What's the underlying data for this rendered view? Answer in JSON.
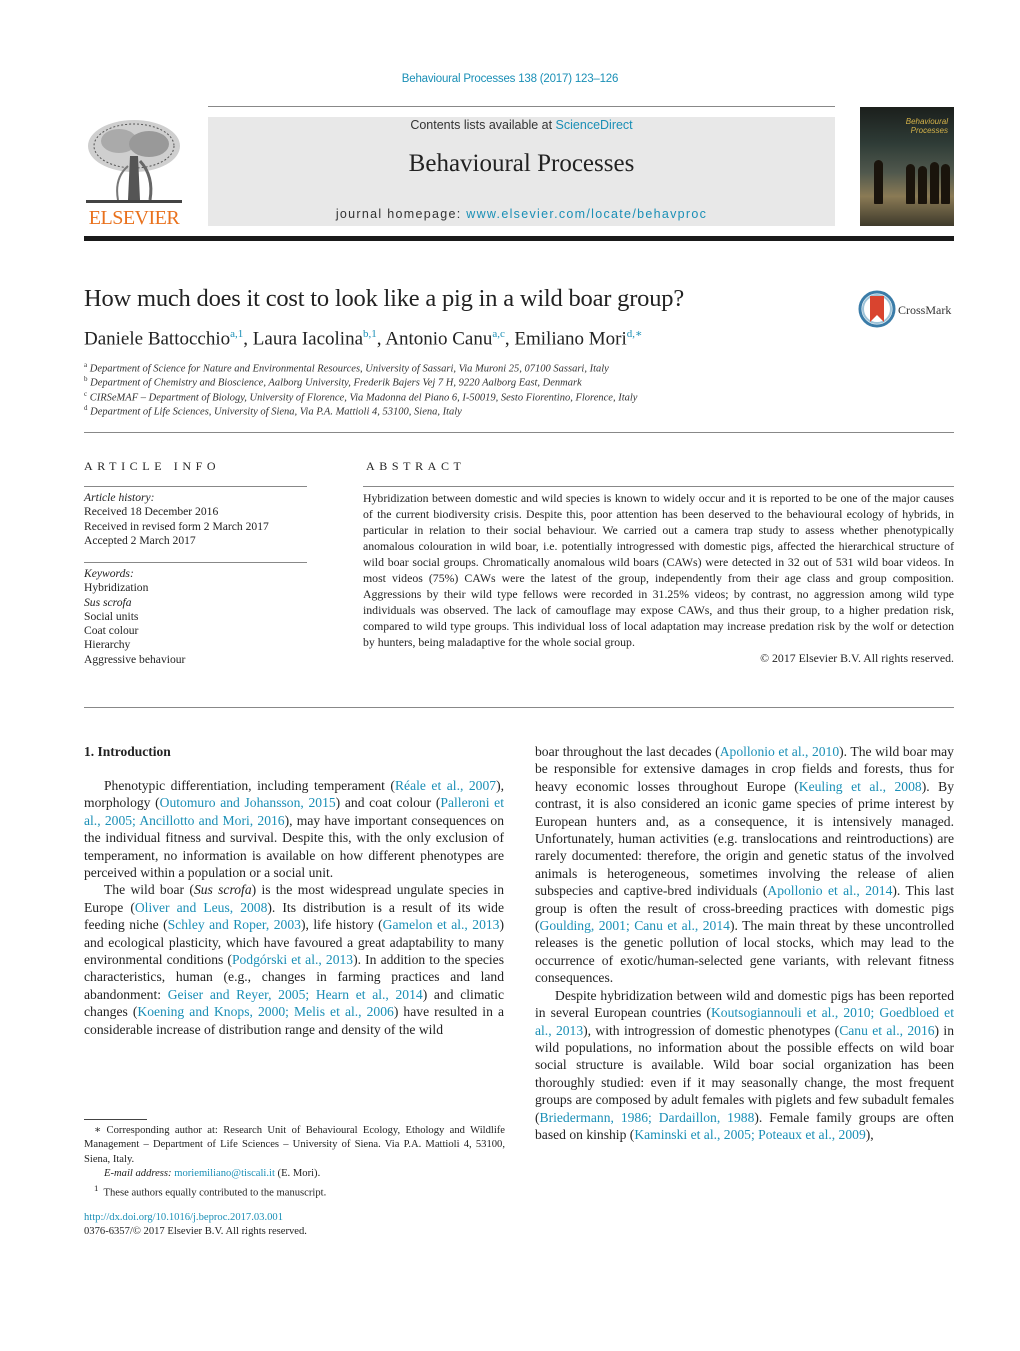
{
  "header": {
    "journal_ref": "Behavioural Processes 138 (2017) 123–126",
    "contents_prefix": "Contents lists available at ",
    "contents_link": "ScienceDirect",
    "journal_title": "Behavioural Processes",
    "homepage_prefix": "journal homepage: ",
    "homepage_link": "www.elsevier.com/locate/behavproc",
    "publisher": "ELSEVIER",
    "cover_title_1": "Behavioural",
    "cover_title_2": "Processes",
    "brand_color": "#e9711c",
    "link_color": "#1a8fb6"
  },
  "article": {
    "title": "How much does it cost to look like a pig in a wild boar group?",
    "crossmark_label": "CrossMark",
    "authors": [
      {
        "name": "Daniele Battocchio",
        "sup": "a,1"
      },
      {
        "name": "Laura Iacolina",
        "sup": "b,1"
      },
      {
        "name": "Antonio Canu",
        "sup": "a,c"
      },
      {
        "name": "Emiliano Mori",
        "sup": "d,∗"
      }
    ],
    "affiliations": [
      {
        "key": "a",
        "text": "Department of Science for Nature and Environmental Resources, University of Sassari, Via Muroni 25, 07100 Sassari, Italy"
      },
      {
        "key": "b",
        "text": "Department of Chemistry and Bioscience, Aalborg University, Frederik Bajers Vej 7 H, 9220 Aalborg East, Denmark"
      },
      {
        "key": "c",
        "text": "CIRSeMAF – Department of Biology, University of Florence, Via Madonna del Piano 6, I-50019, Sesto Fiorentino, Florence, Italy"
      },
      {
        "key": "d",
        "text": "Department of Life Sciences, University of Siena, Via P.A. Mattioli 4, 53100, Siena, Italy"
      }
    ]
  },
  "article_info": {
    "heading": "ARTICLE INFO",
    "history_label": "Article history:",
    "history": [
      "Received 18 December 2016",
      "Received in revised form 2 March 2017",
      "Accepted 2 March 2017"
    ],
    "keywords_label": "Keywords:",
    "keywords": [
      "Hybridization",
      "Sus scrofa",
      "Social units",
      "Coat colour",
      "Hierarchy",
      "Aggressive behaviour"
    ]
  },
  "abstract": {
    "heading": "ABSTRACT",
    "text": "Hybridization between domestic and wild species is known to widely occur and it is reported to be one of the major causes of the current biodiversity crisis. Despite this, poor attention has been deserved to the behavioural ecology of hybrids, in particular in relation to their social behaviour. We carried out a camera trap study to assess whether phenotypically anomalous colouration in wild boar, i.e. potentially introgressed with domestic pigs, affected the hierarchical structure of wild boar social groups. Chromatically anomalous wild boars (CAWs) were detected in 32 out of 531 wild boar videos. In most videos (75%) CAWs were the latest of the group, independently from their age class and group composition. Aggressions by their wild type fellows were recorded in 31.25% videos; by contrast, no aggression among wild type individuals was observed. The lack of camouflage may expose CAWs, and thus their group, to a higher predation risk, compared to wild type groups. This individual loss of local adaptation may increase predation risk by the wolf or detection by hunters, being maladaptive for the whole social group.",
    "copyright": "© 2017 Elsevier B.V. All rights reserved."
  },
  "body": {
    "section_heading": "1.  Introduction",
    "p1": [
      {
        "t": "Phenotypic differentiation, including temperament ("
      },
      {
        "t": "Réale et al., 2007",
        "link": true
      },
      {
        "t": "), morphology ("
      },
      {
        "t": "Outomuro and Johansson, 2015",
        "link": true
      },
      {
        "t": ") and coat colour ("
      },
      {
        "t": "Palleroni et al., 2005; Ancillotto and Mori, 2016",
        "link": true
      },
      {
        "t": "), may have important consequences on the individual fitness and survival. Despite this, with the only exclusion of temperament, no information is available on how different phenotypes are perceived within a population or a social unit."
      }
    ],
    "p2": [
      {
        "t": "The wild boar ("
      },
      {
        "t": "Sus scrofa",
        "italic": true
      },
      {
        "t": ") is the most widespread ungulate species in Europe ("
      },
      {
        "t": "Oliver and Leus, 2008",
        "link": true
      },
      {
        "t": "). Its distribution is a result of its wide feeding niche ("
      },
      {
        "t": "Schley and Roper, 2003",
        "link": true
      },
      {
        "t": "), life history ("
      },
      {
        "t": "Gamelon et al., 2013",
        "link": true
      },
      {
        "t": ") and ecological plasticity, which have favoured a great adaptability to many environmental conditions ("
      },
      {
        "t": "Podgórski et al., 2013",
        "link": true
      },
      {
        "t": "). In addition to the species characteristics, human (e.g., changes in farming practices and land abandonment: "
      },
      {
        "t": "Geiser and Reyer, 2005; Hearn et al., 2014",
        "link": true
      },
      {
        "t": ") and climatic changes ("
      },
      {
        "t": "Koening and Knops, 2000; Melis et al., 2006",
        "link": true
      },
      {
        "t": ") have resulted in a considerable increase of distribution range and density of the wild"
      }
    ],
    "p3": [
      {
        "t": "boar throughout the last decades ("
      },
      {
        "t": "Apollonio et al., 2010",
        "link": true
      },
      {
        "t": "). The wild boar may be responsible for extensive damages in crop fields and forests, thus for heavy economic losses throughout Europe ("
      },
      {
        "t": "Keuling et al., 2008",
        "link": true
      },
      {
        "t": "). By contrast, it is also considered an iconic game species of prime interest by European hunters and, as a consequence, it is intensively managed. Unfortunately, human activities (e.g. translocations and reintroductions) are rarely documented: therefore, the origin and genetic status of the involved animals is heterogeneous, sometimes involving the release of alien subspecies and captive-bred individuals ("
      },
      {
        "t": "Apollonio et al., 2014",
        "link": true
      },
      {
        "t": "). This last group is often the result of cross-breeding practices with domestic pigs ("
      },
      {
        "t": "Goulding, 2001; Canu et al., 2014",
        "link": true
      },
      {
        "t": "). The main threat by these uncontrolled releases is the genetic pollution of local stocks, which may lead to the occurrence of exotic/human-selected gene variants, with relevant fitness consequences."
      }
    ],
    "p4": [
      {
        "t": "Despite hybridization between wild and domestic pigs has been reported in several European countries ("
      },
      {
        "t": "Koutsogiannouli et al., 2010; Goedbloed et al., 2013",
        "link": true
      },
      {
        "t": "), with introgression of domestic phenotypes ("
      },
      {
        "t": "Canu et al., 2016",
        "link": true
      },
      {
        "t": ") in wild populations, no information about the possible effects on wild boar social structure is available. Wild boar social organization has been thoroughly studied: even if it may seasonally change, the most frequent groups are composed by adult females with piglets and few subadult females ("
      },
      {
        "t": "Briedermann, 1986; Dardaillon, 1988",
        "link": true
      },
      {
        "t": "). Female family groups are often based on kinship ("
      },
      {
        "t": "Kaminski et al., 2005; Poteaux et al., 2009",
        "link": true
      },
      {
        "t": "),"
      }
    ]
  },
  "footnotes": {
    "corresponding": "∗  Corresponding author at: Research Unit of Behavioural Ecology, Ethology and Wildlife Management – Department of Life Sciences – University of Siena. Via P.A. Mattioli 4, 53100, Siena, Italy.",
    "email_label": "E-mail address: ",
    "email": "moriemiliano@tiscali.it",
    "email_suffix": " (E. Mori).",
    "equal_sup": "1",
    "equal": "These authors equally contributed to the manuscript.",
    "doi": "http://dx.doi.org/10.1016/j.beproc.2017.03.001",
    "issn": "0376-6357/© 2017 Elsevier B.V. All rights reserved."
  }
}
